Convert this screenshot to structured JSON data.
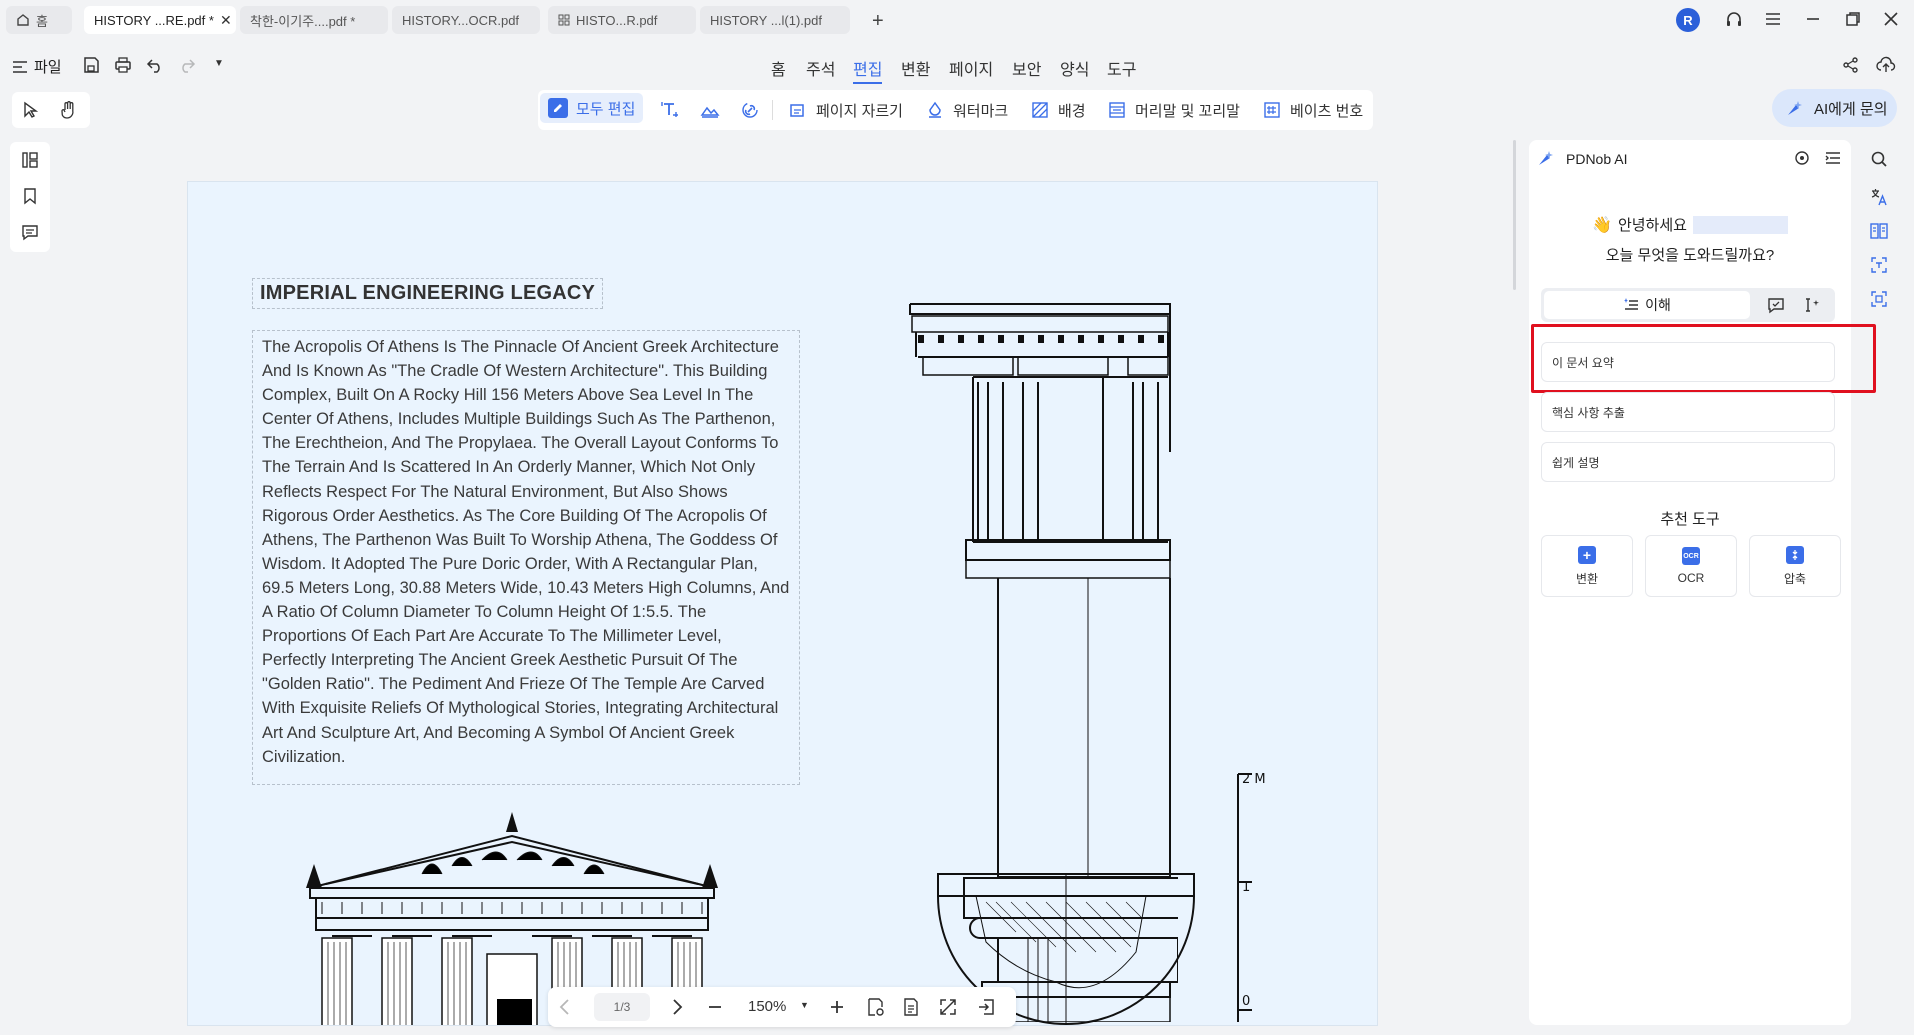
{
  "tabs": [
    {
      "label": "홈"
    },
    {
      "label": "HISTORY ...RE.pdf *"
    },
    {
      "label": "착한-이기주....pdf *"
    },
    {
      "label": "HISTORY...OCR.pdf"
    },
    {
      "label": "HISTO...R.pdf"
    },
    {
      "label": "HISTORY ...l(1).pdf"
    }
  ],
  "window": {
    "avatar_letter": "R"
  },
  "file_menu": {
    "label": "파일"
  },
  "menu": [
    "홈",
    "주석",
    "편집",
    "변환",
    "페이지",
    "보안",
    "양식",
    "도구"
  ],
  "edit_toolbar": {
    "edit_all": "모두 편집",
    "crop": "페이지 자르기",
    "watermark": "워터마크",
    "background": "배경",
    "header_footer": "머리말 및 꼬리말",
    "bates": "베이츠 번호"
  },
  "ask_ai": {
    "label": "AI에게 문의"
  },
  "document": {
    "title": "IMPERIAL ENGINEERING LEGACY",
    "body": "The Acropolis Of Athens Is The Pinnacle Of Ancient Greek Architecture And Is Known As \"The Cradle Of Western Architecture\". This Building Complex, Built On A Rocky Hill 156 Meters Above Sea Level In The Center Of Athens, Includes Multiple Buildings Such As The Parthenon, The Erechtheion, And The Propylaea. The Overall Layout Conforms To The Terrain And Is Scattered In An Orderly Manner, Which Not Only Reflects Respect For The Natural Environment, But Also Shows Rigorous Order Aesthetics. As The Core Building Of The Acropolis Of Athens, The Parthenon Was Built To Worship Athena, The Goddess Of Wisdom. It Adopted The Pure Doric Order, With A Rectangular Plan, 69.5 Meters Long, 30.88 Meters Wide, 10.43 Meters High Columns, And A Ratio Of Column Diameter To Column Height Of 1:5.5. The Proportions Of Each Part Are Accurate To The Millimeter Level, Perfectly Interpreting The Ancient Greek Aesthetic Pursuit Of The \"Golden Ratio\". The Pediment And Frieze Of The Temple Are Carved With Exquisite Reliefs Of Mythological Stories, Integrating Architectural Art And Sculpture Art, And Becoming A Symbol Of Ancient Greek Civilization.",
    "scale_labels": [
      "2 M",
      "1",
      "0"
    ]
  },
  "page_nav": {
    "page": "1/3",
    "zoom": "150%"
  },
  "ai_panel": {
    "title": "PDNob AI",
    "greeting": "안녕하세요",
    "subgreeting": "오늘 무엇을 도와드릴까요?",
    "mode_tab": "이해",
    "suggestions": [
      "이 문서 요약",
      "핵심 사항 추출",
      "쉽게 설명"
    ],
    "tools_title": "추천 도구",
    "tools": [
      "변환",
      "OCR",
      "압축"
    ]
  },
  "colors": {
    "accent": "#3b6ee8",
    "highlight": "#e0101f",
    "page_bg": "#eaf4fe"
  }
}
